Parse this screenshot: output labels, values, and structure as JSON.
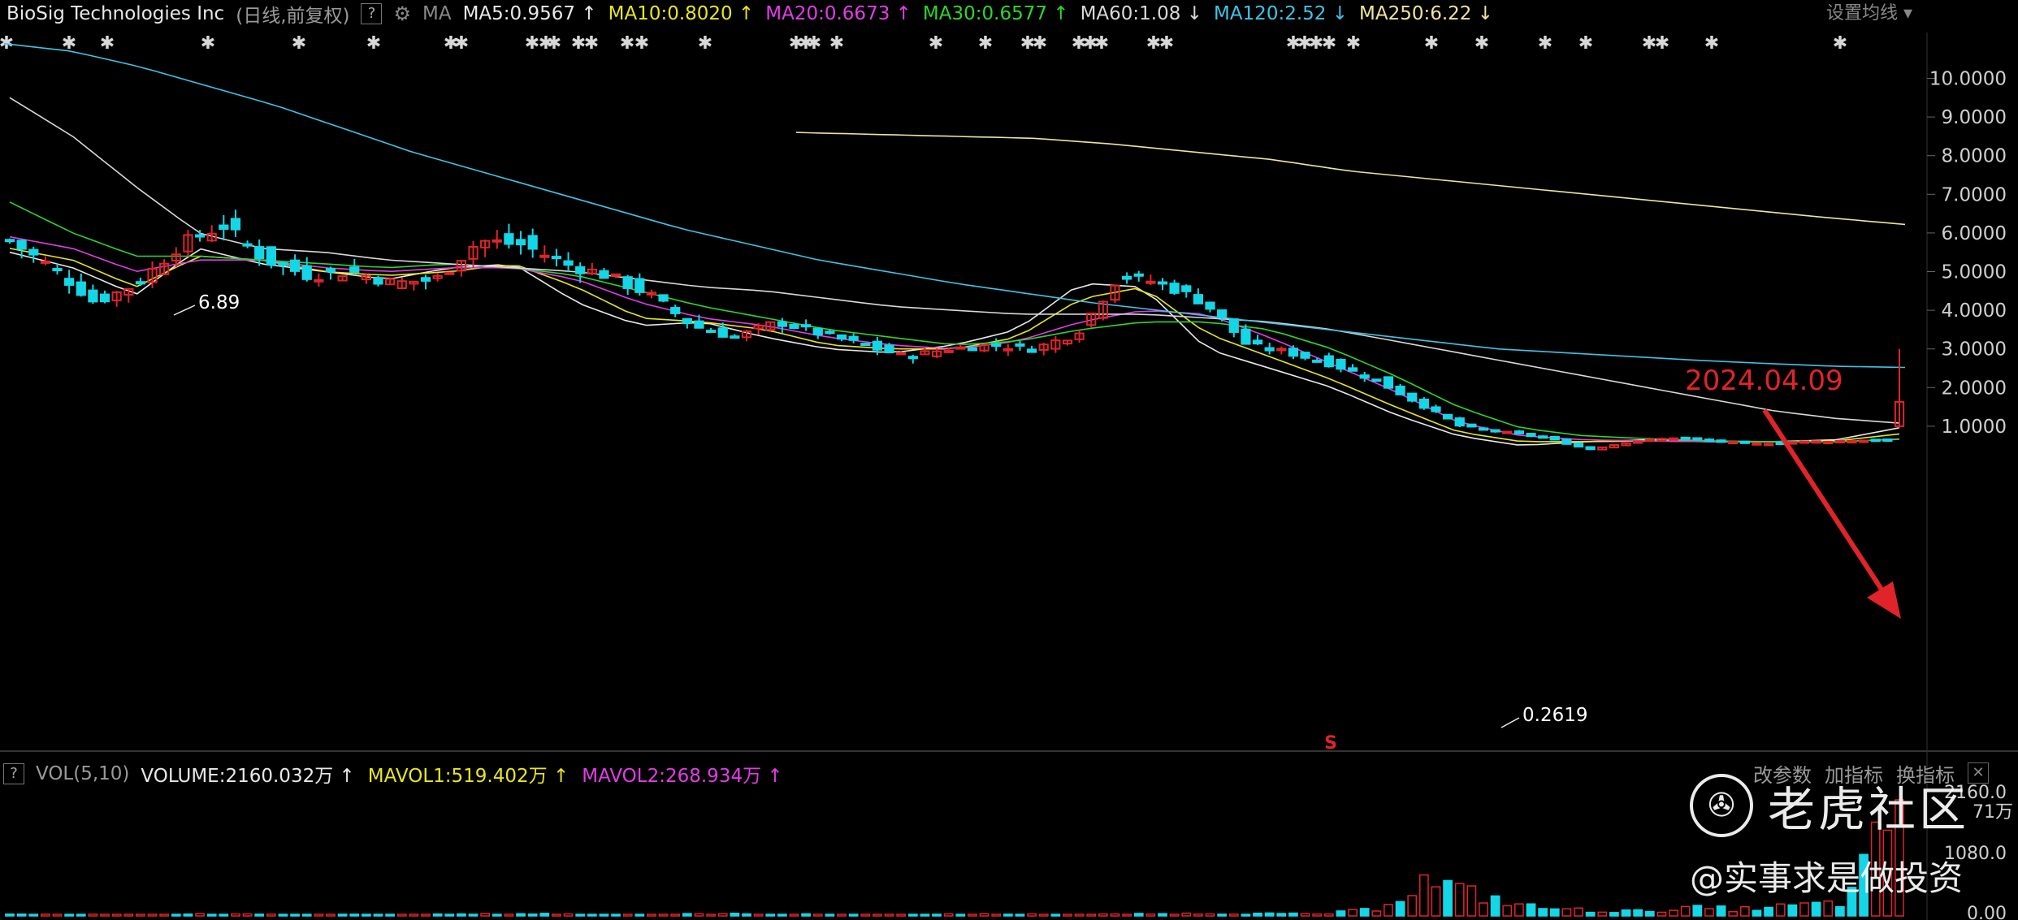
{
  "header": {
    "title": "BioSig Technologies Inc",
    "adjust_label": "(日线,前复权)",
    "help_icon": "question-icon",
    "gear_icon": "gear-icon",
    "ma_label": "MA",
    "settings_label": "设置均线",
    "ma_values": [
      {
        "text": "MA5:0.9567",
        "color": "#e8e8e8",
        "arrow": "↑"
      },
      {
        "text": "MA10:0.8020",
        "color": "#e8e61c",
        "arrow": "↑"
      },
      {
        "text": "MA20:0.6673",
        "color": "#e23ce6",
        "arrow": "↑"
      },
      {
        "text": "MA30:0.6577",
        "color": "#2ed52e",
        "arrow": "↑"
      },
      {
        "text": "MA60:1.08",
        "color": "#d8d8d8",
        "arrow": "↓"
      },
      {
        "text": "MA120:2.52",
        "color": "#3ec4e6",
        "arrow": "↓"
      },
      {
        "text": "MA250:6.22",
        "color": "#efe3a0",
        "arrow": "↓"
      }
    ]
  },
  "volume_header": {
    "help_icon": "question-icon",
    "label": "VOL(5,10)",
    "volume": {
      "text": "VOLUME:2160.032万",
      "arrow": "↑",
      "color": "#e8e8e8"
    },
    "mavol1": {
      "text": "MAVOL1:519.402万",
      "arrow": "↑",
      "color": "#e8e61c"
    },
    "mavol2": {
      "text": "MAVOL2:268.934万",
      "arrow": "↑",
      "color": "#e23ce6"
    },
    "buttons": [
      "改参数",
      "加指标",
      "换指标"
    ],
    "close_icon": "close-icon"
  },
  "watermark": {
    "logo_icon": "tiger-logo-icon",
    "text": "老虎社区",
    "handle": "@实事求是做投资"
  },
  "annotation": {
    "text": "2024.04.09",
    "color": "#e0242a"
  },
  "special_marker": "S",
  "colors": {
    "up": "#e0242a",
    "down": "#14d6e6",
    "background": "#000000",
    "grid": "#202020"
  },
  "chart_data": {
    "type": "candlestick",
    "y_axis_ticks": [
      "10.0000",
      "9.0000",
      "8.0000",
      "7.0000",
      "6.0000",
      "5.0000",
      "4.0000",
      "3.0000",
      "2.0000",
      "1.0000"
    ],
    "ylim": [
      0,
      11.2
    ],
    "high_label": "6.89",
    "low_label": "0.2619",
    "volume_axis_ticks": [
      "2160.0",
      "1080.0",
      "0.00"
    ],
    "volume_unit": "71万",
    "last": {
      "open": 1.0,
      "close": 1.63,
      "high": 3.0,
      "low": 0.95
    },
    "ma_series": [
      {
        "name": "MA5",
        "color": "#e8e8e8",
        "anchors": [
          5.5,
          5.1,
          4.4,
          5.6,
          5.2,
          5.0,
          4.8,
          5.1,
          5.2,
          4.2,
          3.6,
          3.7,
          3.3,
          3.0,
          2.9,
          3.1,
          3.5,
          4.7,
          4.6,
          3.0,
          2.5,
          2.0,
          1.3,
          0.75,
          0.5,
          0.6,
          0.65,
          0.6,
          0.6,
          0.65,
          0.96
        ]
      },
      {
        "name": "MA10",
        "color": "#e8e61c",
        "anchors": [
          5.6,
          5.3,
          4.6,
          5.4,
          5.3,
          5.0,
          4.9,
          5.0,
          5.2,
          4.6,
          3.8,
          3.7,
          3.5,
          3.1,
          3.0,
          3.0,
          3.3,
          4.3,
          4.6,
          3.4,
          2.8,
          2.2,
          1.5,
          0.85,
          0.6,
          0.6,
          0.62,
          0.6,
          0.6,
          0.62,
          0.8
        ]
      },
      {
        "name": "MA20",
        "color": "#e23ce6",
        "anchors": [
          5.9,
          5.6,
          5.0,
          5.3,
          5.3,
          5.1,
          5.0,
          5.1,
          5.1,
          4.8,
          4.2,
          3.8,
          3.6,
          3.3,
          3.1,
          3.0,
          3.2,
          3.7,
          4.0,
          3.9,
          3.3,
          2.6,
          1.9,
          1.1,
          0.75,
          0.65,
          0.62,
          0.6,
          0.6,
          0.6,
          0.67
        ]
      },
      {
        "name": "MA30",
        "color": "#2ed52e",
        "anchors": [
          6.8,
          6.0,
          5.4,
          5.4,
          5.3,
          5.2,
          5.1,
          5.2,
          5.1,
          4.9,
          4.5,
          4.1,
          3.8,
          3.5,
          3.3,
          3.1,
          3.2,
          3.5,
          3.7,
          3.7,
          3.5,
          3.0,
          2.3,
          1.5,
          0.95,
          0.75,
          0.68,
          0.62,
          0.6,
          0.6,
          0.66
        ]
      },
      {
        "name": "MA60",
        "color": "#d8d8d8",
        "anchors": [
          9.5,
          8.5,
          7.2,
          6.0,
          5.6,
          5.5,
          5.3,
          5.2,
          5.1,
          5.0,
          4.8,
          4.6,
          4.5,
          4.3,
          4.1,
          4.0,
          3.9,
          3.9,
          3.9,
          3.8,
          3.7,
          3.5,
          3.2,
          2.9,
          2.6,
          2.3,
          2.0,
          1.7,
          1.4,
          1.2,
          1.08
        ]
      },
      {
        "name": "MA120",
        "color": "#3ec4e6",
        "anchors": [
          10.9,
          10.7,
          10.3,
          9.8,
          9.3,
          8.7,
          8.1,
          7.6,
          7.1,
          6.6,
          6.1,
          5.7,
          5.3,
          5.0,
          4.7,
          4.45,
          4.2,
          4.0,
          3.8,
          3.6,
          3.4,
          3.2,
          3.0,
          2.9,
          2.8,
          2.7,
          2.62,
          2.55,
          2.52
        ]
      },
      {
        "name": "MA250",
        "color": "#efe3a0",
        "anchors": [
          8.6,
          8.55,
          8.5,
          8.45,
          8.3,
          8.1,
          7.9,
          7.6,
          7.4,
          7.2,
          7.0,
          6.8,
          6.6,
          6.4,
          6.22
        ]
      }
    ],
    "close_anchors": [
      5.8,
      5.1,
      4.2,
      4.7,
      5.7,
      6.2,
      5.3,
      4.9,
      5.0,
      4.7,
      4.8,
      5.8,
      5.7,
      5.2,
      4.9,
      4.4,
      3.6,
      3.3,
      3.7,
      3.4,
      3.1,
      2.8,
      3.0,
      3.1,
      3.0,
      3.4,
      4.9,
      4.7,
      4.2,
      3.1,
      2.9,
      2.6,
      2.2,
      1.6,
      1.0,
      0.85,
      0.7,
      0.4,
      0.6,
      0.7,
      0.6,
      0.55,
      0.6,
      0.62,
      0.65,
      1.63
    ],
    "volume_profile": [
      6,
      8,
      5,
      7,
      9,
      6,
      5,
      7,
      6,
      8,
      10,
      7,
      6,
      8,
      9,
      7,
      6,
      5,
      7,
      8,
      6,
      7,
      9,
      12,
      10,
      8,
      30,
      160,
      90,
      40,
      25,
      20,
      35,
      30,
      45,
      60,
      520
    ]
  }
}
